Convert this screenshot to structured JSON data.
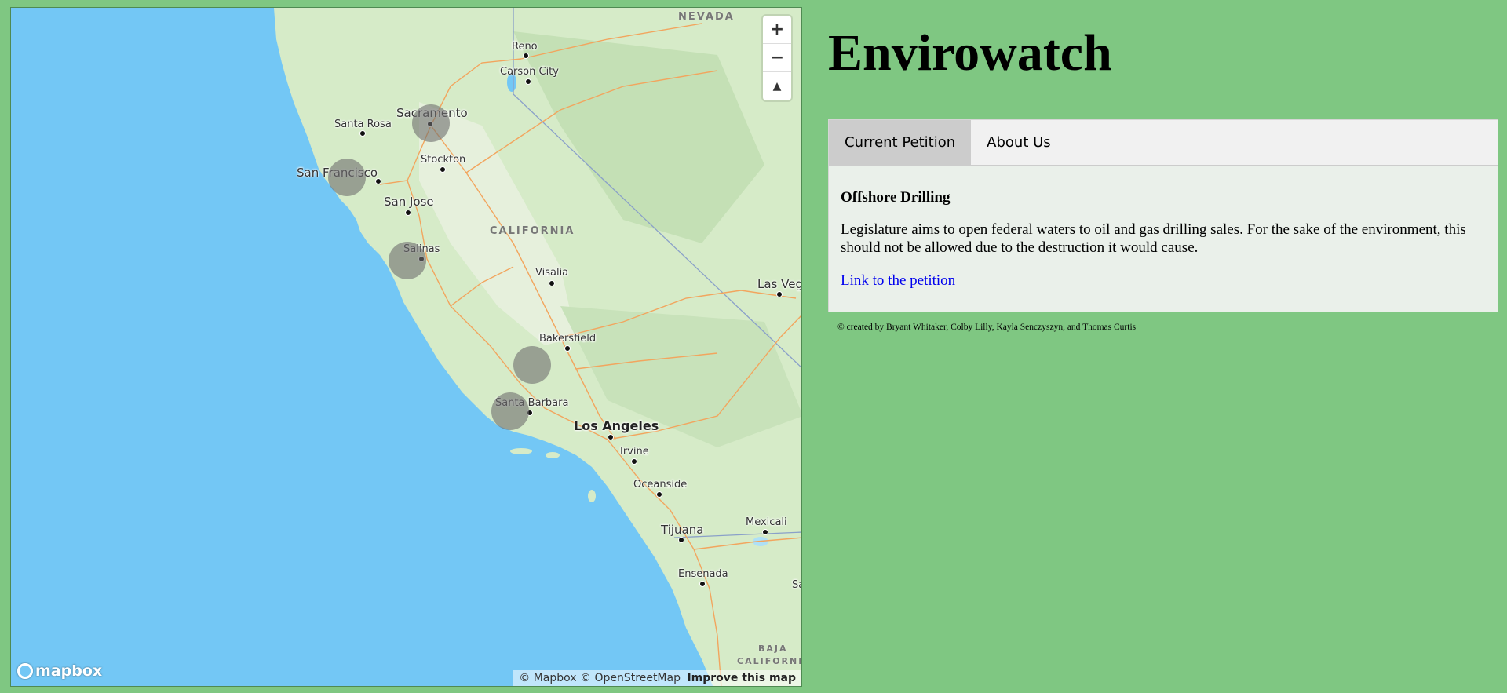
{
  "header": {
    "title": "Envirowatch"
  },
  "tabs": [
    {
      "label": "Current Petition",
      "active": true
    },
    {
      "label": "About Us",
      "active": false
    }
  ],
  "petition": {
    "title": "Offshore Drilling",
    "description": "Legislature aims to open federal waters to oil and gas drilling sales. For the sake of the environment, this should not be allowed due to the destruction it would cause.",
    "link_label": "Link to the petition"
  },
  "footer": {
    "credit": "© created by Bryant Whitaker, Colby Lilly, Kayla Senczyszyn, and Thomas Curtis"
  },
  "map": {
    "controls": {
      "zoom_in": "+",
      "zoom_out": "−",
      "compass": "▲"
    },
    "logo": "mapbox",
    "attribution": {
      "mapbox": "© Mapbox",
      "osm": "© OpenStreetMap",
      "improve": "Improve this map"
    },
    "regions": {
      "nevada": "NEVADA",
      "california": "CALIFORNIA",
      "baja": "BAJA",
      "baja2": "CALIFORNIA"
    },
    "cities": {
      "reno": "Reno",
      "carson": "Carson City",
      "sacramento": "Sacramento",
      "santa_rosa": "Santa Rosa",
      "stockton": "Stockton",
      "san_francisco": "San Francisco",
      "san_jose": "San Jose",
      "salinas": "Salinas",
      "visalia": "Visalia",
      "las_vegas": "Las Vegas",
      "bakersfield": "Bakersfield",
      "santa_barbara": "Santa Barbara",
      "los_angeles": "Los Angeles",
      "irvine": "Irvine",
      "oceanside": "Oceanside",
      "tijuana": "Tijuana",
      "mexicali": "Mexicali",
      "ensenada": "Ensenada",
      "sa": "Sa"
    },
    "colors": {
      "water": "#73c7f5",
      "land": "#d6ebc8",
      "roads": "#f2a55e",
      "markers": "#6e6e6e"
    }
  }
}
